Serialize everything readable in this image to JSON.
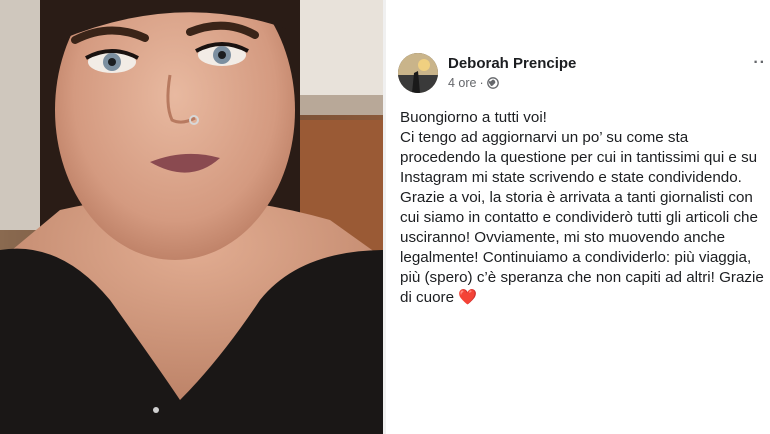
{
  "post": {
    "author": "Deborah Prencipe",
    "time": "4 ore",
    "separator": "·",
    "privacy_icon": "globe-icon",
    "more_icon": "more-options-icon",
    "more_glyph": "··",
    "lines": [
      "Buongiorno a tutti voi!",
      "Ci tengo ad aggiornarvi un po’ su come sta",
      "procedendo la questione per cui in tantissimi qui e su",
      "Instagram mi state scrivendo e state condividendo.",
      "Grazie a voi, la storia è arrivata a tanti giornalisti con",
      "cui siamo in contatto e condividerò tutti gli articoli che",
      "usciranno! Ovviamente, mi sto muovendo anche",
      "legalmente! Continuiamo a condividerlo: più viaggia,",
      "più (spero) c’è speranza che non capiti ad altri! Grazie",
      "di cuore"
    ],
    "heart_emoji": "❤️"
  },
  "colors": {
    "text": "#1c1e21",
    "meta": "#65676b",
    "heart": "#e0245e"
  }
}
